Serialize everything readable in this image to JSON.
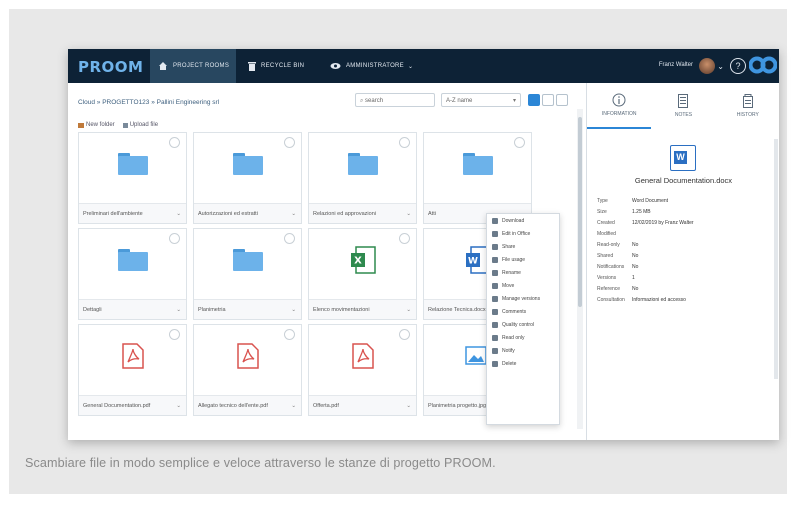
{
  "app": {
    "logo": "PROOM",
    "nav": [
      {
        "label": "PROJECT ROOMS",
        "icon": "home-icon",
        "active": true
      },
      {
        "label": "RECYCLE BIN",
        "icon": "trash-icon",
        "active": false
      },
      {
        "label": "AMMINISTRATORE",
        "icon": "eye-icon",
        "active": false
      }
    ],
    "user_name": "Franz Walter",
    "help": "?"
  },
  "breadcrumb": "Cloud » PROGETTO123 » Pallini Engineering srl",
  "search": {
    "placeholder": "search"
  },
  "sort": {
    "value": "A-Z name"
  },
  "actions": {
    "new_folder": "New folder",
    "upload": "Upload file"
  },
  "files": [
    {
      "name": "Preliminari dell'ambiente",
      "type": "folder"
    },
    {
      "name": "Autorizzazioni ed estratti",
      "type": "folder"
    },
    {
      "name": "Relazioni ed approvazioni",
      "type": "folder"
    },
    {
      "name": "Atti",
      "type": "folder"
    },
    {
      "name": "Dettagli",
      "type": "folder"
    },
    {
      "name": "Planimetria",
      "type": "folder"
    },
    {
      "name": "Elenco movimentazioni",
      "type": "excel"
    },
    {
      "name": "Relazione Tecnica.docx",
      "type": "word"
    },
    {
      "name": "General Documentation.pdf",
      "type": "pdf"
    },
    {
      "name": "Allegato tecnico dell'ente.pdf",
      "type": "pdf"
    },
    {
      "name": "Offerta.pdf",
      "type": "pdf"
    },
    {
      "name": "Planimetria progetto.jpg",
      "type": "image"
    }
  ],
  "context_menu": [
    "Download",
    "Edit in Office",
    "Share",
    "File usage",
    "Rename",
    "Move",
    "Manage versions",
    "Comments",
    "Quality control",
    "Read only",
    "Notify",
    "Delete"
  ],
  "panel": {
    "tabs": [
      {
        "label": "INFORMATION",
        "icon": "info-icon"
      },
      {
        "label": "NOTES",
        "icon": "notes-icon"
      },
      {
        "label": "HISTORY",
        "icon": "history-icon"
      }
    ],
    "file_title": "General Documentation.docx",
    "properties": [
      {
        "k": "Type",
        "v": "Word Document"
      },
      {
        "k": "Size",
        "v": "1.25 MB"
      },
      {
        "k": "Created",
        "v": "12/02/2019 by Franz Walter"
      },
      {
        "k": "Modified",
        "v": ""
      },
      {
        "k": "Read-only",
        "v": "No"
      },
      {
        "k": "Shared",
        "v": "No"
      },
      {
        "k": "Notifications",
        "v": "No"
      },
      {
        "k": "Versions",
        "v": "1"
      },
      {
        "k": "Reference",
        "v": "No"
      },
      {
        "k": "Consultation",
        "v": "Informazioni ed accesso"
      }
    ]
  },
  "caption": "Scambiare file in modo semplice e veloce attraverso le stanze di progetto PROOM."
}
